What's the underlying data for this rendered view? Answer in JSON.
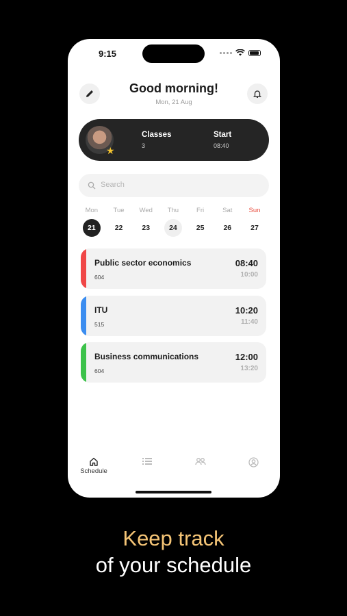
{
  "status_bar": {
    "time": "9:15"
  },
  "header": {
    "greeting": "Good morning!",
    "date": "Mon, 21 Aug",
    "edit_icon": "pencil-icon",
    "notification_icon": "bell-icon"
  },
  "summary": {
    "classes_label": "Classes",
    "classes_value": "3",
    "start_label": "Start",
    "start_value": "08:40"
  },
  "search": {
    "placeholder": "Search"
  },
  "week": [
    {
      "name": "Mon",
      "num": "21",
      "state": "selected"
    },
    {
      "name": "Tue",
      "num": "22",
      "state": ""
    },
    {
      "name": "Wed",
      "num": "23",
      "state": ""
    },
    {
      "name": "Thu",
      "num": "24",
      "state": "today"
    },
    {
      "name": "Fri",
      "num": "25",
      "state": ""
    },
    {
      "name": "Sat",
      "num": "26",
      "state": ""
    },
    {
      "name": "Sun",
      "num": "27",
      "state": "weekend"
    }
  ],
  "classes": [
    {
      "title": "Public sector economics",
      "room": "604",
      "start": "08:40",
      "end": "10:00",
      "color": "#f04747"
    },
    {
      "title": "ITU",
      "room": "515",
      "start": "10:20",
      "end": "11:40",
      "color": "#3b8df0"
    },
    {
      "title": "Business communications",
      "room": "604",
      "start": "12:00",
      "end": "13:20",
      "color": "#3cc24a"
    }
  ],
  "tabbar": {
    "schedule_label": "Schedule"
  },
  "promo": {
    "line1": "Keep track",
    "line2": "of your schedule",
    "accent": "#f4c476"
  }
}
